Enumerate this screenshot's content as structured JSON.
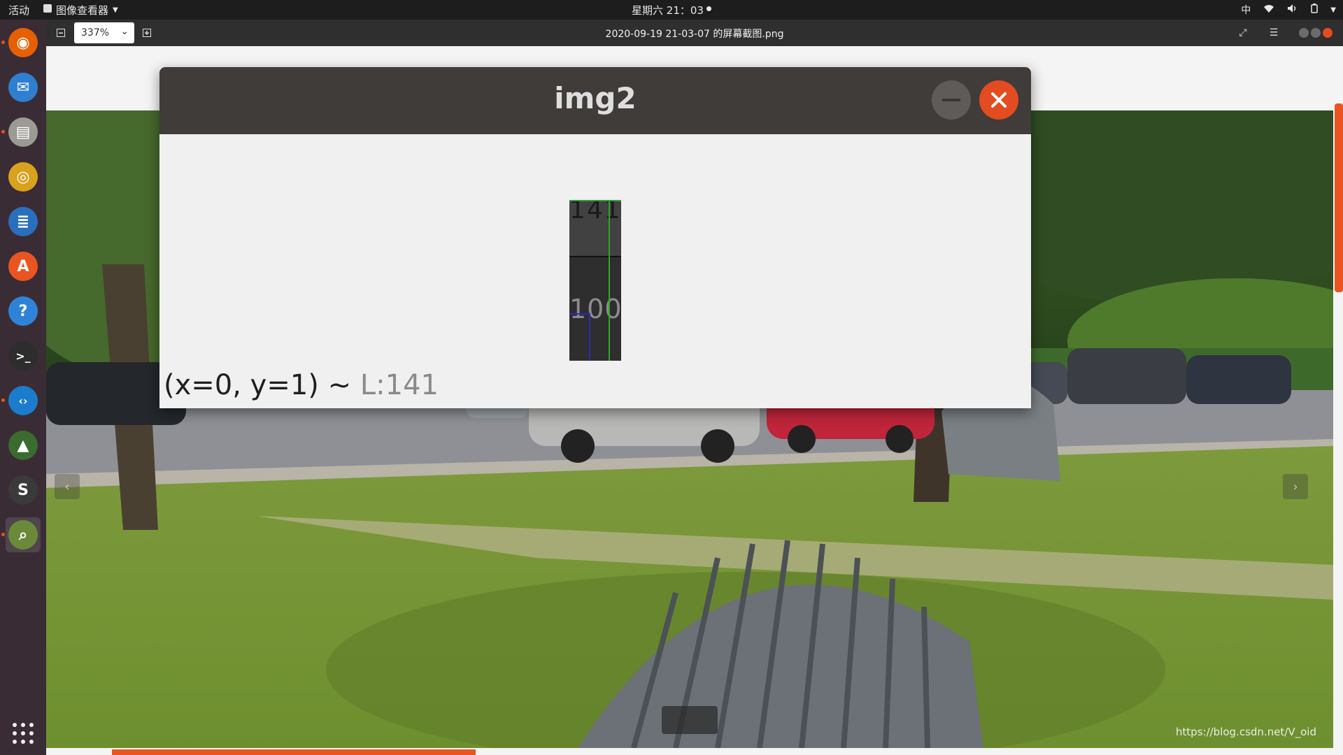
{
  "topbar": {
    "activities": "活动",
    "app_name": "图像查看器",
    "clock": "星期六 21：03",
    "input_method": "中"
  },
  "dock": {
    "items": [
      {
        "name": "firefox",
        "icon": "firefox-icon",
        "color": "#e66000",
        "active": false
      },
      {
        "name": "thunderbird",
        "icon": "mail-icon",
        "color": "#2f7fd1",
        "active": false
      },
      {
        "name": "files",
        "icon": "files-icon",
        "color": "#9c9a95",
        "active": false
      },
      {
        "name": "rhythmbox",
        "icon": "music-icon",
        "color": "#d9a21e",
        "active": false
      },
      {
        "name": "libreoffice-writer",
        "icon": "writer-icon",
        "color": "#2a6fbd",
        "active": false
      },
      {
        "name": "software",
        "icon": "software-store-icon",
        "color": "#e95420",
        "active": false
      },
      {
        "name": "help",
        "icon": "help-icon",
        "color": "#2f83d7",
        "active": false
      },
      {
        "name": "terminal",
        "icon": "terminal-icon",
        "color": "#2d2d2d",
        "active": false
      },
      {
        "name": "vscode",
        "icon": "vscode-icon",
        "color": "#1c7ccc",
        "active": false
      },
      {
        "name": "inkscape",
        "icon": "inkscape-icon",
        "color": "#3b6b2e",
        "active": false
      },
      {
        "name": "sublime",
        "icon": "sublime-icon",
        "color": "#3a3a3a",
        "active": false
      },
      {
        "name": "image-viewer",
        "icon": "image-viewer-icon",
        "color": "#6a8a3a",
        "active": true
      }
    ],
    "show_apps_icon": "app-grid-icon"
  },
  "viewer": {
    "zoom": "337%",
    "file_title": "2020-09-19 21-03-07 的屏幕截图.png",
    "watermark": "https://blog.csdn.net/V_oid"
  },
  "cv_window": {
    "title": "img2",
    "pixel_top_value": "141",
    "pixel_bottom_value": "100",
    "status_coords": "(x=0, y=1) ~ ",
    "status_value": "L:141"
  }
}
